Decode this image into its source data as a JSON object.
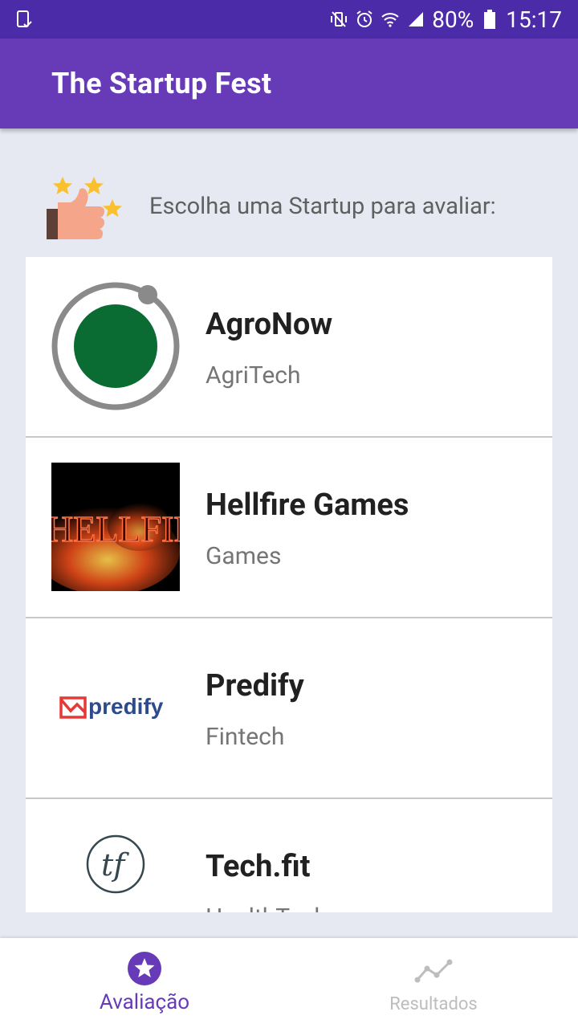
{
  "status_bar": {
    "battery": "80%",
    "time": "15:17"
  },
  "app_bar": {
    "title": "The Startup Fest"
  },
  "prompt": {
    "text": "Escolha uma Startup para avaliar:"
  },
  "startups": [
    {
      "name": "AgroNow",
      "category": "AgriTech",
      "logo": "agronow-logo"
    },
    {
      "name": "Hellfire Games",
      "category": "Games",
      "logo": "hellfire-logo"
    },
    {
      "name": "Predify",
      "category": "Fintech",
      "logo": "predify-logo"
    },
    {
      "name": "Tech.fit",
      "category": "HealthTech",
      "logo": "techfit-logo"
    }
  ],
  "logos": {
    "predify_text": "predify",
    "hellfire_text": "HELLFIRE",
    "techfit_text": "tf"
  },
  "bottom_nav": {
    "items": [
      {
        "label": "Avaliação",
        "icon": "star-icon",
        "active": true
      },
      {
        "label": "Resultados",
        "icon": "chart-line-icon",
        "active": false
      }
    ]
  },
  "colors": {
    "primary": "#673AB7",
    "primary_dark": "#4B2BA8",
    "active_nav": "#673AB7",
    "inactive_nav": "#BDBDBD"
  }
}
